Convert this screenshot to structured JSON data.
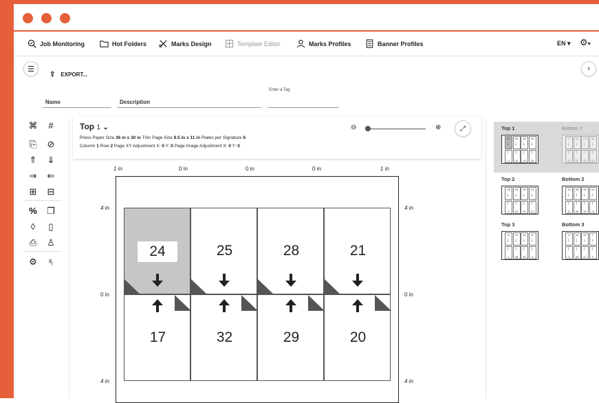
{
  "window": {
    "accent": "#e5603a"
  },
  "menu": {
    "items": [
      {
        "id": "job-monitoring",
        "label": "Job Monitoring",
        "icon": "job-monitoring-icon",
        "enabled": true
      },
      {
        "id": "hot-folders",
        "label": "Hot Folders",
        "icon": "folder-icon",
        "enabled": true
      },
      {
        "id": "marks-design",
        "label": "Marks Design",
        "icon": "crossed-tools-icon",
        "enabled": true
      },
      {
        "id": "template-editor",
        "label": "Template Editor",
        "icon": "template-icon",
        "enabled": false
      },
      {
        "id": "marks-profiles",
        "label": "Marks Profiles",
        "icon": "person-icon",
        "enabled": true
      },
      {
        "id": "banner-profiles",
        "label": "Banner Profiles",
        "icon": "document-icon",
        "enabled": true
      }
    ],
    "language": "EN"
  },
  "toolbar": {
    "export_label": "EXPORT..."
  },
  "fields": {
    "name_label": "Name",
    "description_label": "Description",
    "tag_label": "Enter a Tag"
  },
  "signature": {
    "title": "Top",
    "number": "1",
    "press_paper_size_label": "Press Paper Size",
    "press_paper_size": "36 in x 30 in",
    "trim_page_size_label": "Trim Page Size",
    "trim_page_size": "8.5 in x 11 in",
    "plates_label": "Plates per Signature",
    "plates": "6",
    "column_label": "Column",
    "column": "1",
    "row_label": "Row",
    "row": "2",
    "page_xy_label": "Page XY Adjustment X:",
    "page_xy_x": "0",
    "page_xy_y_label": "Y:",
    "page_xy_y": "0",
    "page_image_label": "Page Image Adjustment X:",
    "page_image_x": "0",
    "page_image_y_label": "Y:",
    "page_image_y": "0"
  },
  "rulers": {
    "top": [
      "1 in",
      "0 in",
      "0 in",
      "0 in",
      "1 in"
    ],
    "left": [
      "4 in",
      "0 in",
      "4 in"
    ],
    "right": [
      "4 in",
      "0 in",
      "4 in"
    ]
  },
  "imposition": {
    "top_row": [
      "24",
      "25",
      "28",
      "21"
    ],
    "bottom_row": [
      "17",
      "32",
      "29",
      "20"
    ],
    "selected_page": "24"
  },
  "signatures_panel": [
    {
      "label": "Top 1",
      "active": true,
      "top": [
        "24",
        "25",
        "28",
        "21"
      ],
      "bottom": [
        "17",
        "32",
        "29",
        "20"
      ]
    },
    {
      "label": "Bottom 1",
      "active": false,
      "top": [
        "27",
        "22",
        "23",
        "26"
      ],
      "bottom": [
        "19",
        "30",
        "31",
        "18"
      ]
    },
    {
      "label": "Top 2",
      "active": false,
      "top": [
        "16",
        "33",
        "36",
        "13"
      ],
      "bottom": [
        "9",
        "40",
        "37",
        "12"
      ]
    },
    {
      "label": "Bottom 2",
      "active": false,
      "top": [
        "14",
        "35",
        "34",
        "15"
      ],
      "bottom": [
        "11",
        "38",
        "39",
        "10"
      ]
    },
    {
      "label": "Top 3",
      "active": false,
      "top": [
        "8",
        "41",
        "44",
        "5"
      ],
      "bottom": [
        "1",
        "48",
        "45",
        "4"
      ]
    },
    {
      "label": "Bottom 3",
      "active": false,
      "top": [
        "6",
        "43",
        "42",
        "7"
      ],
      "bottom": [
        "3",
        "46",
        "47",
        "2"
      ]
    }
  ]
}
